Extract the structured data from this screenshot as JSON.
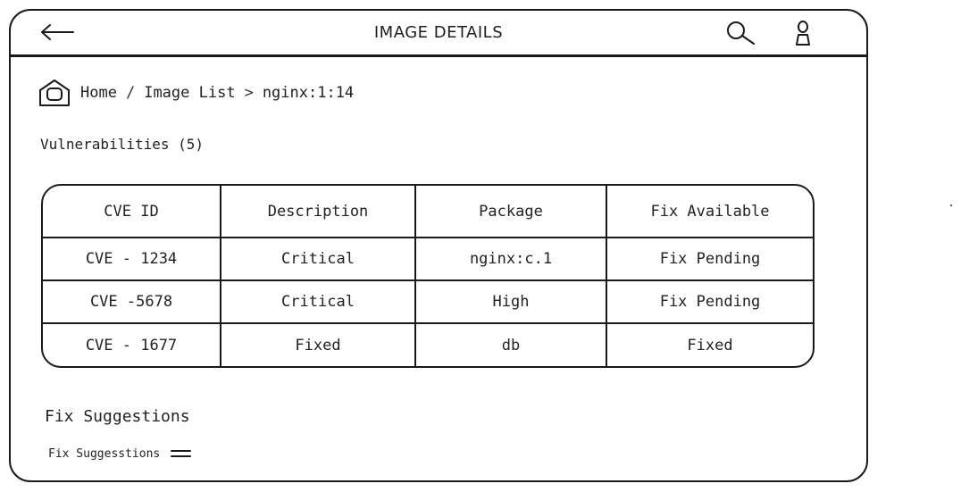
{
  "header": {
    "title": "IMAGE DETAILS"
  },
  "breadcrumb": {
    "home": "Home",
    "separator_1": "/",
    "image_list": "Image List",
    "separator_2": ">",
    "current": "nginx:1:14"
  },
  "vulnerabilities": {
    "title": "Vulnerabilities (5)",
    "columns": [
      "CVE ID",
      "Description",
      "Package",
      "Fix Available"
    ],
    "rows": [
      [
        "CVE - 1234",
        "Critical",
        "nginx:c.1",
        "Fix Pending"
      ],
      [
        "CVE -5678",
        "Critical",
        "High",
        "Fix Pending"
      ],
      [
        "CVE - 1677",
        "Fixed",
        "db",
        "Fixed"
      ]
    ]
  },
  "fix_suggestions": {
    "title": "Fix Suggestions",
    "sub_label": "Fix Suggesstions"
  },
  "icons": {
    "back": "arrow-left-icon",
    "search": "search-icon",
    "user": "user-icon",
    "home": "home-icon",
    "menu": "menu-icon"
  },
  "colors": {
    "line": "#1a1a1a",
    "text": "#222222",
    "background": "#ffffff"
  }
}
